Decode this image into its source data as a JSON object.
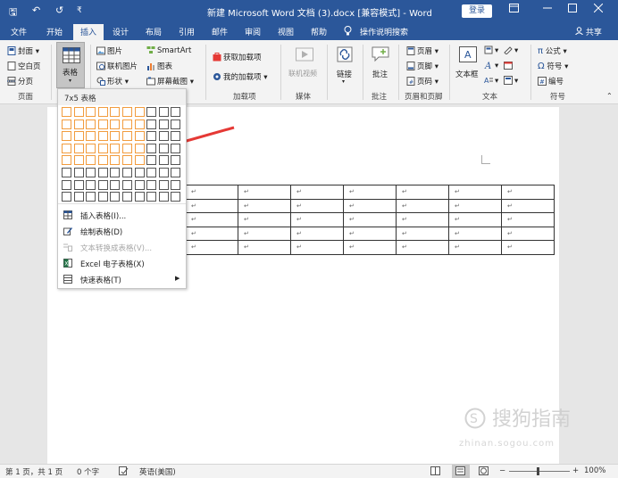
{
  "titlebar": {
    "title": "新建 Microsoft Word 文档 (3).docx [兼容模式] - Word",
    "login": "登录",
    "undo_glyph": "↶",
    "redo_glyph": "↺",
    "save_glyph": "🖫",
    "more_glyph": "₹"
  },
  "tabs": [
    "文件",
    "开始",
    "插入",
    "设计",
    "布局",
    "引用",
    "邮件",
    "审阅",
    "视图",
    "帮助"
  ],
  "active_tab": "插入",
  "search_tab": "操作说明搜索",
  "share": "共享",
  "ribbon": {
    "pages": {
      "cover": "封面",
      "blank": "空白页",
      "break": "分页",
      "label": "页面"
    },
    "table": {
      "label": "表格"
    },
    "illustrations": {
      "picture": "图片",
      "online_picture": "联机图片",
      "shape": "形状",
      "smartart": "SmartArt",
      "chart": "图表",
      "screenshot": "屏幕截图"
    },
    "addins": {
      "get": "获取加载项",
      "my": "我的加载项",
      "label": "加载项"
    },
    "media": {
      "video": "联机视频",
      "label": "媒体"
    },
    "links": {
      "link": "链接"
    },
    "comments": {
      "comment": "批注",
      "label": "批注"
    },
    "header_footer": {
      "header": "页眉",
      "footer": "页脚",
      "page_number": "页码",
      "label": "页眉和页脚"
    },
    "text": {
      "textbox": "文本框",
      "label": "文本"
    },
    "symbols": {
      "equation": "公式",
      "symbol": "符号",
      "number": "编号",
      "label": "符号"
    }
  },
  "table_dropdown": {
    "header": "7x5 表格",
    "grid_cols": 10,
    "grid_rows": 8,
    "selected_cols": 7,
    "selected_rows": 5,
    "items": [
      {
        "label": "插入表格(I)...",
        "disabled": false
      },
      {
        "label": "绘制表格(D)",
        "disabled": false
      },
      {
        "label": "文本转换成表格(V)...",
        "disabled": true
      },
      {
        "label": "Excel 电子表格(X)",
        "disabled": false
      },
      {
        "label": "快速表格(T)",
        "disabled": false,
        "submenu": true
      }
    ]
  },
  "document": {
    "table_rows": 5,
    "table_cols": 7,
    "cell_mark": "↵"
  },
  "watermark": {
    "brand": "搜狗指南",
    "url": "zhinan.sogou.com"
  },
  "statusbar": {
    "page": "第 1 页，共 1 页",
    "words": "0 个字",
    "language": "英语(美国)",
    "zoom": "100%"
  },
  "colors": {
    "word_blue": "#2b579a",
    "grid_highlight": "#f29c3e",
    "arrow_red": "#e53935"
  }
}
